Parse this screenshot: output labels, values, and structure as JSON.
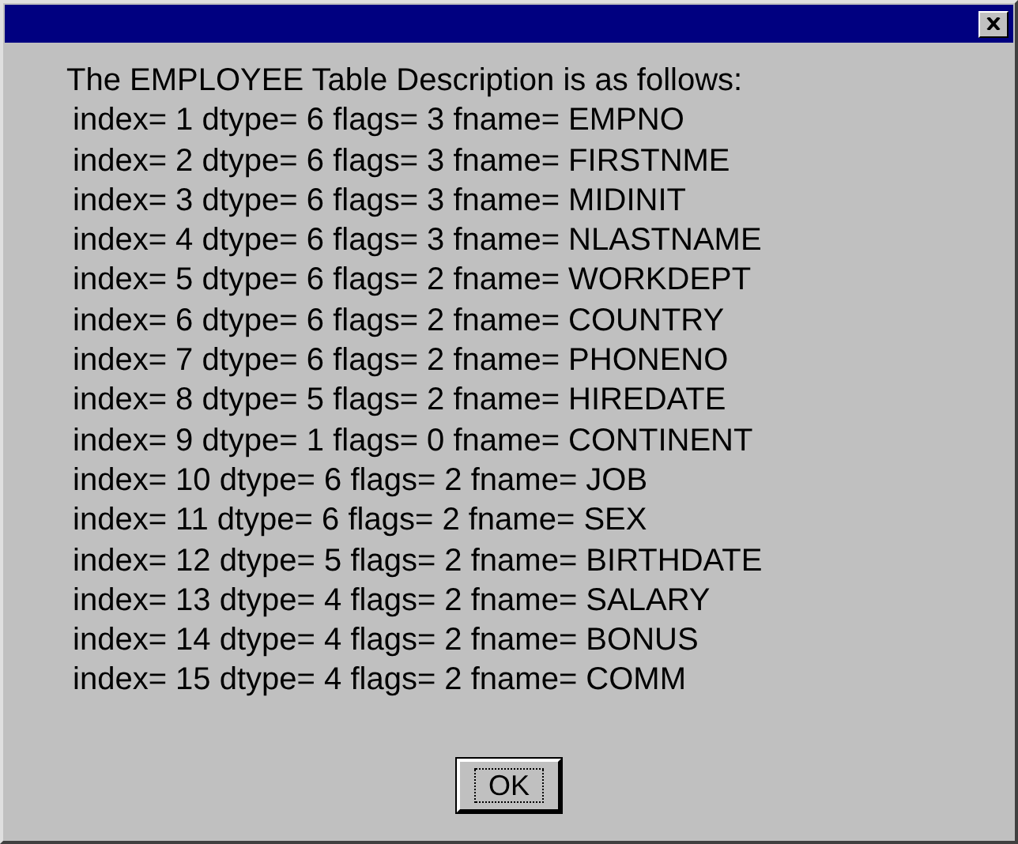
{
  "dialog": {
    "heading": "The EMPLOYEE Table Description is as follows:",
    "lines": [
      "index= 1 dtype= 6 flags= 3 fname= EMPNO",
      "index= 2 dtype= 6 flags= 3 fname= FIRSTNME",
      "index= 3 dtype= 6 flags= 3 fname= MIDINIT",
      "index= 4 dtype= 6 flags= 3 fname= NLASTNAME",
      "index= 5 dtype= 6 flags= 2 fname= WORKDEPT",
      "index= 6 dtype= 6 flags= 2 fname= COUNTRY",
      "index= 7 dtype= 6 flags= 2 fname= PHONENO",
      "index= 8 dtype= 5 flags= 2 fname= HIREDATE",
      "index= 9 dtype= 1 flags= 0 fname= CONTINENT",
      "index= 10 dtype= 6 flags= 2 fname= JOB",
      "index= 11 dtype= 6 flags= 2 fname= SEX",
      "index= 12 dtype= 5 flags= 2 fname= BIRTHDATE",
      "index= 13 dtype= 4 flags= 2 fname= SALARY",
      "index= 14 dtype= 4 flags= 2 fname= BONUS",
      "index= 15 dtype= 4 flags= 2 fname= COMM"
    ],
    "button": "OK"
  }
}
